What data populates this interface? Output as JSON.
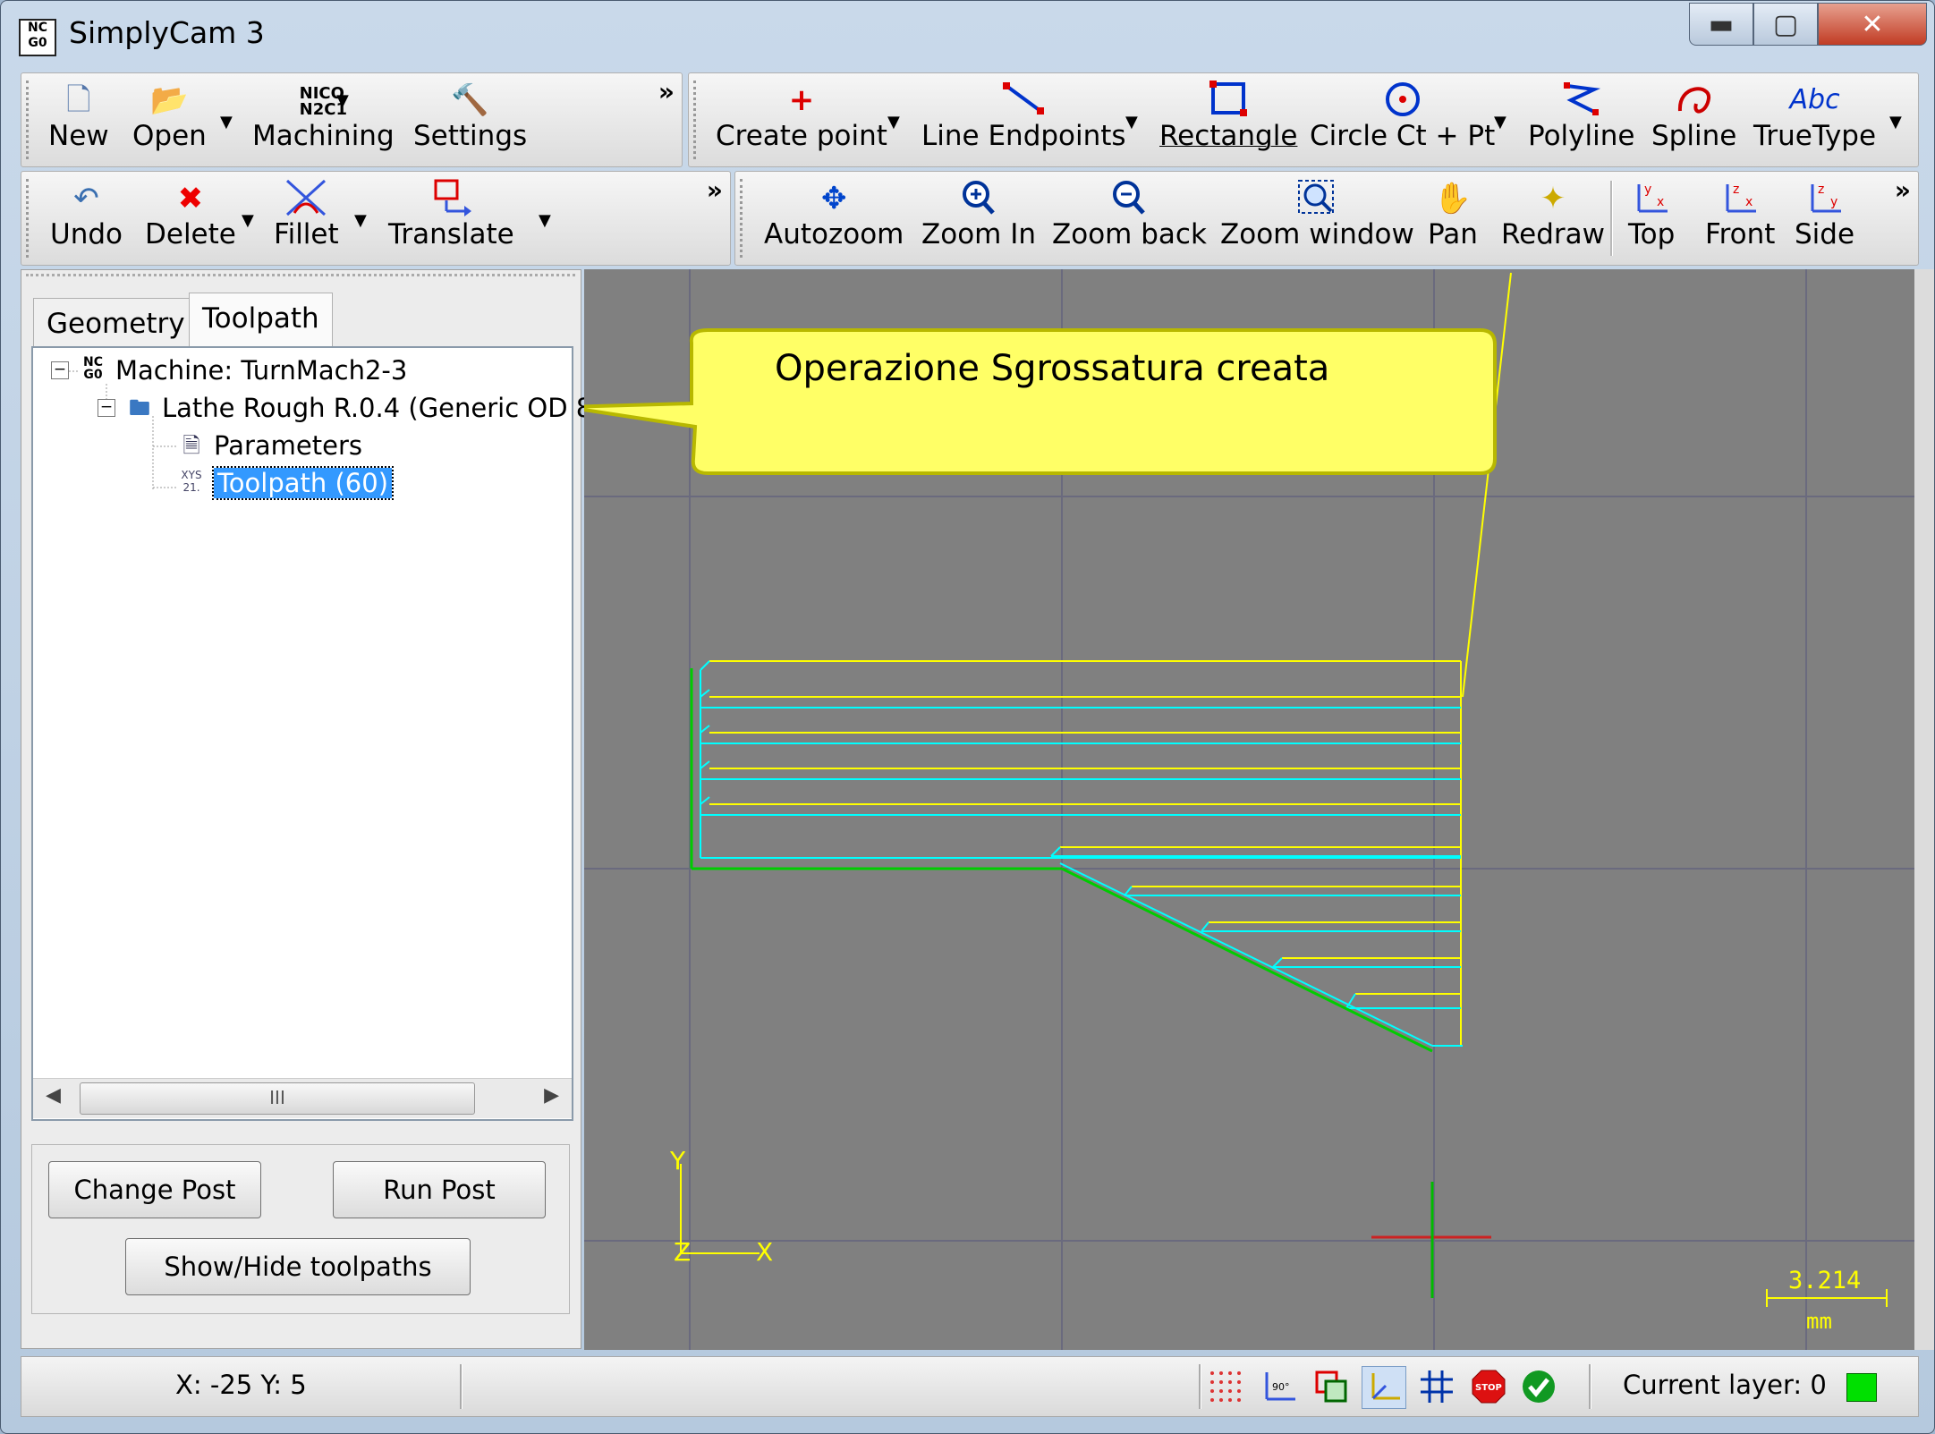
{
  "window": {
    "title": "SimplyCam 3",
    "app_icon": "nc-program-icon"
  },
  "toolbar_file": {
    "new": "New",
    "open": "Open",
    "machining": "Machining",
    "settings": "Settings"
  },
  "toolbar_draw": {
    "create_point": "Create point",
    "line_endpoints": "Line Endpoints",
    "rectangle": "Rectangle",
    "circle": "Circle Ct + Pt",
    "polyline": "Polyline",
    "spline": "Spline",
    "truetype": "TrueType",
    "truetype_icon_text": "Abc"
  },
  "toolbar_edit": {
    "undo": "Undo",
    "delete": "Delete",
    "fillet": "Fillet",
    "translate": "Translate"
  },
  "toolbar_view": {
    "autozoom": "Autozoom",
    "zoom_in": "Zoom In",
    "zoom_back": "Zoom back",
    "zoom_window": "Zoom window",
    "pan": "Pan",
    "redraw": "Redraw",
    "top": "Top",
    "front": "Front",
    "side": "Side"
  },
  "overflow_glyph": "»",
  "tabs": [
    {
      "label": "Geometry"
    },
    {
      "label": "Toolpath",
      "active": true
    }
  ],
  "tree": {
    "machine": "Machine: TurnMach2-3",
    "operation": "Lathe Rough R.0.4 (Generic OD 8",
    "parameters": "Parameters",
    "toolpath": "Toolpath (60)"
  },
  "scroll_thumb_glyph": "III",
  "buttons": {
    "change_post": "Change Post",
    "run_post": "Run Post",
    "show_hide": "Show/Hide toolpaths"
  },
  "viewport": {
    "callout": "Operazione Sgrossatura creata",
    "axis_x": "X",
    "axis_y": "Y",
    "axis_z": "Z",
    "scale_value": "3.214",
    "scale_unit": "mm",
    "colors": {
      "background": "#808080",
      "toolpath_yellow": "#ffff00",
      "toolpath_cyan": "#00ffff",
      "geometry_green": "#00cc00"
    }
  },
  "status": {
    "coords": "X: -25 Y: 5",
    "layer": "Current layer: 0",
    "layer_color": "#00e000"
  }
}
